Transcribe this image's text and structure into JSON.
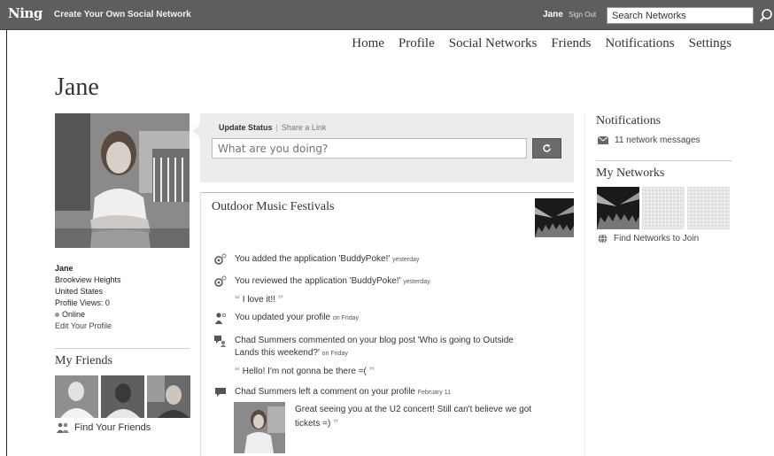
{
  "topbar": {
    "logo": "Ning",
    "tagline": "Create Your Own Social Network",
    "user": "Jane",
    "signout": "Sign Out",
    "search_value": "Search Networks"
  },
  "nav": [
    "Home",
    "Profile",
    "Social Networks",
    "Friends",
    "Notifications",
    "Settings"
  ],
  "page_title": "Jane",
  "profile": {
    "name": "Jane",
    "location_city": "Brookview Heights",
    "location_country": "United States",
    "profile_views": "Profile Views: 0",
    "status": "Online",
    "edit": "Edit Your Profile"
  },
  "friends": {
    "title": "My Friends",
    "find": "Find Your Friends"
  },
  "status": {
    "tab_update": "Update Status",
    "tab_share": "Share a Link",
    "placeholder": "What are you doing?"
  },
  "feed": {
    "title": "Outdoor Music Festivals",
    "items": [
      {
        "text": "You added the application 'BuddyPoke!'",
        "time": "yesterday"
      },
      {
        "text": "You reviewed the application 'BuddyPoke!'",
        "time": "yesterday",
        "quote": "I love it!!"
      },
      {
        "text": "You updated your profile",
        "time": "on Friday"
      },
      {
        "text_a": "Chad Summers commented on your blog post 'Who is going to Outside",
        "text_b": "Lands this weekend?'",
        "time": "on Friday",
        "quote": "Hello! I'm not gonna be there =("
      },
      {
        "text": "Chad Summers left a comment on your profile",
        "time": "February 11"
      }
    ],
    "comment_line1": "Great seeing you at the U2 concert! Still can't believe we got",
    "comment_line2": "tickets =)"
  },
  "notifications": {
    "title": "Notifications",
    "item": "11 network messages"
  },
  "networks": {
    "title": "My Networks",
    "find": "Find Networks to Join"
  }
}
